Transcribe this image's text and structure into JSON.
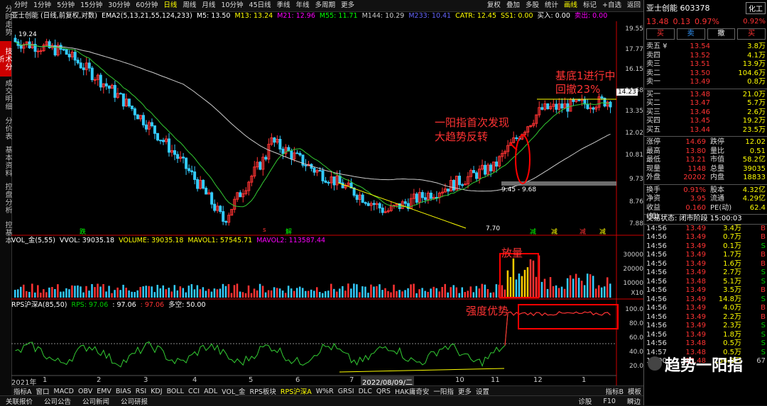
{
  "left_tabs": [
    "分时走势",
    "技术分析",
    "成交明细",
    "分价表",
    "基本资料",
    "控盘分析",
    "控基本"
  ],
  "toolbar": {
    "periods": [
      "分时",
      "1分钟",
      "5分钟",
      "15分钟",
      "30分钟",
      "60分钟",
      "日线",
      "周线",
      "月线",
      "10分钟",
      "45日线",
      "季线",
      "年线",
      "多周期",
      "更多"
    ],
    "selected_period": "日线",
    "right_buttons": [
      "复权",
      "叠加",
      "多股",
      "统计",
      "画线",
      "标记",
      "+自选",
      "返回"
    ]
  },
  "main_info": {
    "name": "亚士创能 (日线,前复权,对数)",
    "ema": "EMA2(5,13,21,55,124,233)",
    "m5": "M5: 13.50",
    "m13": "M13: 13.24",
    "m21": "M21: 12.96",
    "m55": "M55: 11.71",
    "m144": "M144: 10.29",
    "m233": "M233: 10.41",
    "catr": "CATR: 12.45",
    "ss1": "SS1: 0.00",
    "buy": "买入: 0.00",
    "sell": "卖出: 0.00"
  },
  "price_axis": [
    "19.55",
    "17.77",
    "16.15",
    "14.68",
    "13.35",
    "12.02",
    "10.81",
    "9.73",
    "8.76",
    "7.88"
  ],
  "price_marker": "14.23",
  "price_annotations": {
    "high": "19.24",
    "low": "7.70",
    "range": "9.45 - 9.68"
  },
  "signal_chars": [
    "跌",
    "s",
    "解",
    "减",
    "减",
    "减",
    "减"
  ],
  "volume_info": {
    "label": "VOL_金(5,55)",
    "vvol": "VVOL: 39035.18",
    "volume": "VOLUME: 39035.18",
    "mavol1": "MAVOL1: 57545.71",
    "mavol2": "MAVOL2: 113587.44"
  },
  "volume_axis": [
    "30000",
    "20000",
    "10000"
  ],
  "volume_unit": "X10",
  "rps_info": {
    "label": "RPS沪深A(85,50)",
    "rps1": "RPS: 97.06",
    "rps2": ": 97.06",
    "rps3": ": 97.06",
    "kong": "多空: 50.00"
  },
  "rps_axis": [
    "100.0",
    "80.0",
    "60.0",
    "40.0",
    "20.0"
  ],
  "time_axis": [
    "2021年",
    "1",
    "2",
    "3",
    "4",
    "5",
    "6",
    "7",
    "8",
    "2022/08/09/二",
    "10",
    "11",
    "12",
    "1"
  ],
  "annotations": {
    "a1": "基底1进行中",
    "a2": "回撤23%",
    "a3": "一阳指首次发现",
    "a4": "大趋势反转",
    "a5": "放量",
    "a6": "强度优势"
  },
  "indicator_tabs": [
    "指标A",
    "窗口",
    "MACD",
    "OBV",
    "EMV",
    "BIAS",
    "RSI",
    "KDJ",
    "BOLL",
    "CCI",
    "ADL",
    "VOL_金",
    "RPS板块",
    "RPS沪深A",
    "W%R",
    "GRSI",
    "DLC",
    "QRS",
    "HAK庸奇安",
    "一阳指",
    "更多",
    "设置"
  ],
  "selected_indicator": "RPS沪深A",
  "indicator_tabs_right": [
    "指标B",
    "模板"
  ],
  "status_bar": [
    "关联报价",
    "公司公告",
    "公司新闻",
    "公司研报"
  ],
  "status_right": [
    "诊股",
    "F10",
    "瞬边"
  ],
  "right_panel": {
    "stock_name": "亚士创能 603378",
    "tag": "化工",
    "price": "13.48",
    "change": "0.13",
    "pct": "0.97%",
    "pct_right": "0.92%",
    "buttons": [
      "买",
      "卖",
      "撤",
      "买"
    ],
    "asks": [
      {
        "label": "卖五 ¥",
        "price": "13.54",
        "vol": "3.8万"
      },
      {
        "label": "卖四",
        "price": "13.52",
        "vol": "4.1万"
      },
      {
        "label": "卖三",
        "price": "13.51",
        "vol": "13.9万"
      },
      {
        "label": "卖二",
        "price": "13.50",
        "vol": "104.6万"
      },
      {
        "label": "卖一",
        "price": "13.49",
        "vol": "0.8万"
      }
    ],
    "bids": [
      {
        "label": "买一",
        "price": "13.48",
        "vol": "21.0万"
      },
      {
        "label": "买二",
        "price": "13.47",
        "vol": "5.7万"
      },
      {
        "label": "买三",
        "price": "13.46",
        "vol": "2.6万"
      },
      {
        "label": "买四",
        "price": "13.45",
        "vol": "19.2万"
      },
      {
        "label": "买五",
        "price": "13.44",
        "vol": "23.5万"
      }
    ],
    "stats": [
      {
        "k1": "涨停",
        "v1": "14.69",
        "k2": "跌停",
        "v2": "12.02"
      },
      {
        "k1": "最高",
        "v1": "13.80",
        "k2": "量比",
        "v2": "0.51"
      },
      {
        "k1": "最低",
        "v1": "13.21",
        "k2": "市值",
        "v2": "58.2亿"
      },
      {
        "k1": "现量",
        "v1": "1148",
        "k2": "总量",
        "v2": "39035"
      },
      {
        "k1": "外盘",
        "v1": "20202",
        "k2": "内盘",
        "v2": "18833"
      }
    ],
    "stats2": [
      {
        "k1": "换手",
        "v1": "0.91%",
        "k2": "股本",
        "v2": "4.32亿"
      },
      {
        "k1": "净资",
        "v1": "3.95",
        "k2": "流通",
        "v2": "4.29亿"
      },
      {
        "k1": "收益(加)",
        "v1": "0.160",
        "k2": "PE(动)",
        "v2": "62.4"
      }
    ],
    "trade_status": "交易状态: 闭市阶段 15:00:03",
    "ticks": [
      {
        "t": "14:56",
        "p": "13.49",
        "v": "3.4万",
        "s": "B"
      },
      {
        "t": "14:56",
        "p": "13.49",
        "v": "0.7万",
        "s": "B"
      },
      {
        "t": "14:56",
        "p": "13.49",
        "v": "0.1万",
        "s": "S"
      },
      {
        "t": "14:56",
        "p": "13.49",
        "v": "1.7万",
        "s": "B"
      },
      {
        "t": "14:56",
        "p": "13.49",
        "v": "1.6万",
        "s": "B"
      },
      {
        "t": "14:56",
        "p": "13.49",
        "v": "2.7万",
        "s": "S"
      },
      {
        "t": "14:56",
        "p": "13.48",
        "v": "5.1万",
        "s": "S"
      },
      {
        "t": "14:56",
        "p": "13.49",
        "v": "3.5万",
        "s": "B"
      },
      {
        "t": "14:56",
        "p": "13.49",
        "v": "14.8万",
        "s": "S"
      },
      {
        "t": "14:56",
        "p": "13.49",
        "v": "4.0万",
        "s": "B"
      },
      {
        "t": "14:56",
        "p": "13.49",
        "v": "2.2万",
        "s": "B"
      },
      {
        "t": "14:56",
        "p": "13.49",
        "v": "2.3万",
        "s": "S"
      },
      {
        "t": "14:56",
        "p": "13.49",
        "v": "1.8万",
        "s": "S"
      },
      {
        "t": "14:56",
        "p": "13.48",
        "v": "0.5万",
        "s": "S"
      },
      {
        "t": "14:57",
        "p": "13.48",
        "v": "0.5万",
        "s": "S"
      },
      {
        "t": "15:00",
        "p": "13.48",
        "v": "154.8万",
        "s": "67"
      }
    ],
    "watermark": "趋势一阳指"
  }
}
